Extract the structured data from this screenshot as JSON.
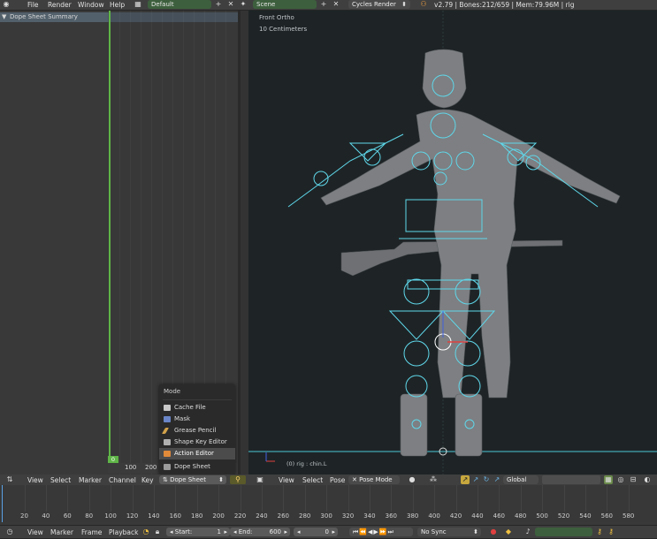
{
  "topbar": {
    "menus": [
      "File",
      "Render",
      "Window",
      "Help"
    ],
    "screen_layout": "Default",
    "scene": "Scene",
    "render_engine": "Cycles Render",
    "stats": "v2.79 | Bones:212/659 | Mem:79.96M | rig"
  },
  "dopesheet": {
    "summary_label": "Dope Sheet Summary",
    "frame_current": "0",
    "frame_labels": [
      "100",
      "200"
    ]
  },
  "mode_menu": {
    "title": "Mode",
    "items": [
      "Cache File",
      "Mask",
      "Grease Pencil",
      "Shape Key Editor",
      "Action Editor",
      "Dope Sheet"
    ],
    "highlighted": "Action Editor"
  },
  "viewport": {
    "view_name": "Front Ortho",
    "scale": "10 Centimeters",
    "object_info": "(0) rig : chin.L"
  },
  "dopesheet_header": {
    "menus": [
      "View",
      "Select",
      "Marker",
      "Channel",
      "Key"
    ],
    "mode_value": "Dope Sheet"
  },
  "viewport_header": {
    "menus": [
      "View",
      "Select",
      "Pose"
    ],
    "mode": "Pose Mode",
    "orientation": "Global"
  },
  "timeline": {
    "ticks": [
      "20",
      "40",
      "60",
      "80",
      "100",
      "120",
      "140",
      "160",
      "180",
      "200",
      "220",
      "240",
      "260",
      "280",
      "300",
      "320",
      "340",
      "360",
      "380",
      "400",
      "420",
      "440",
      "460",
      "480",
      "500",
      "520",
      "540",
      "560",
      "580"
    ]
  },
  "bottombar": {
    "menus": [
      "View",
      "Marker",
      "Frame",
      "Playback"
    ],
    "start_label": "Start:",
    "start_value": "1",
    "end_label": "End:",
    "end_value": "600",
    "current_frame": "0",
    "sync": "No Sync"
  }
}
